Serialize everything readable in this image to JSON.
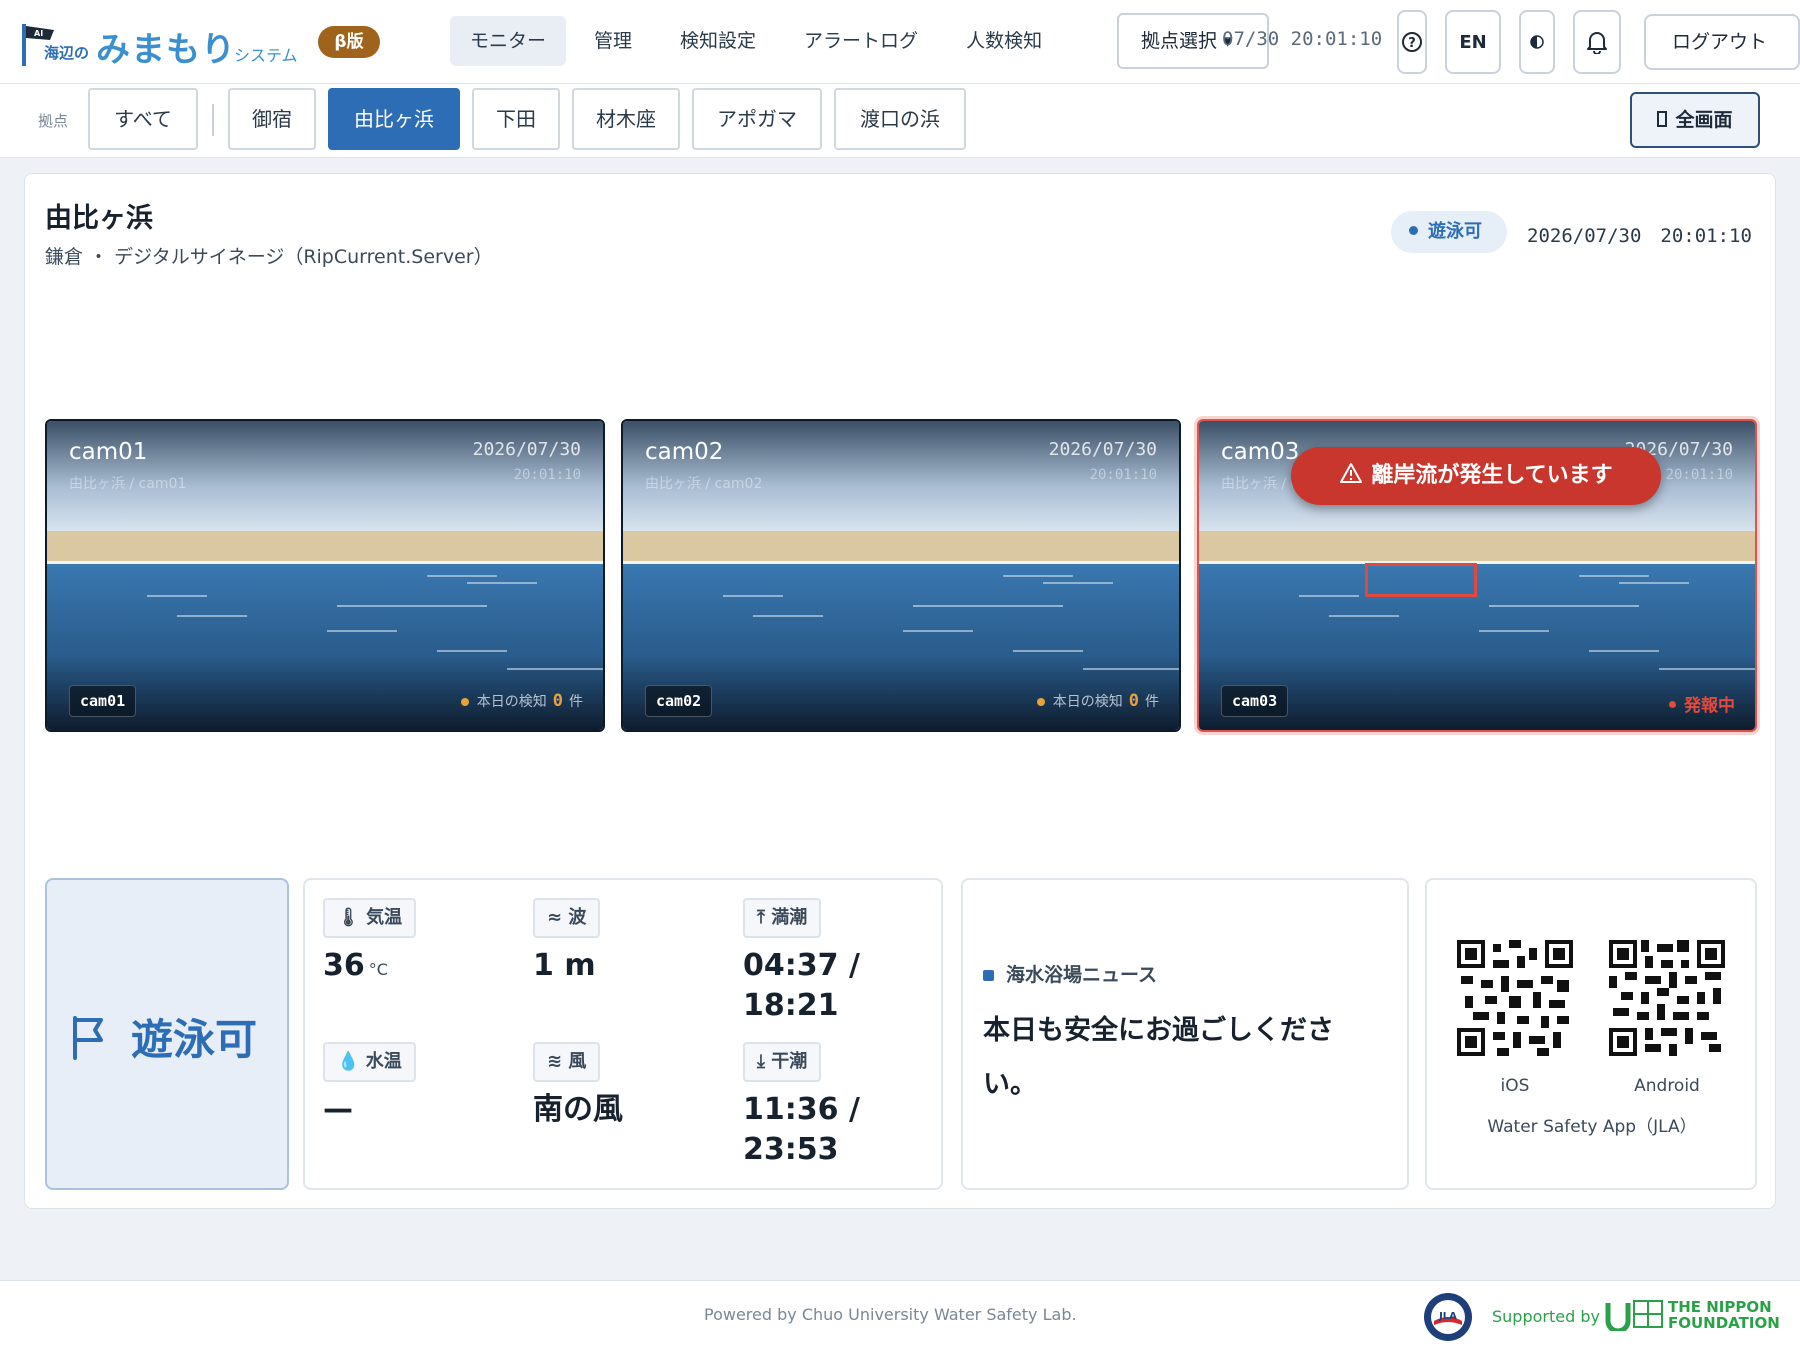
{
  "header": {
    "logo_small": "海辺の",
    "logo_main": "みまもり",
    "logo_system": "システム",
    "beta": "β版",
    "nav": [
      "モニター",
      "管理",
      "検知設定",
      "アラートログ",
      "人数検知"
    ],
    "location_select": "拠点選択 ▾",
    "clock": "07/30 20:01:10",
    "lang": "EN",
    "logout": "ログアウト"
  },
  "sites": {
    "label": "拠点",
    "all": "すべて",
    "items": [
      "御宿",
      "由比ヶ浜",
      "下田",
      "材木座",
      "アポガマ",
      "渡口の浜"
    ],
    "active": "由比ヶ浜",
    "fullscreen": "全画面"
  },
  "beach": {
    "title": "由比ヶ浜",
    "subtitle": "鎌倉 ・ デジタルサイネージ（RipCurrent.Server）",
    "status": "遊泳可",
    "datetime": "2026/07/30　20:01:10"
  },
  "cameras": [
    {
      "name": "cam01",
      "path": "由比ヶ浜 / cam01",
      "date": "2026/07/30",
      "time": "20:01:10",
      "chip": "cam01",
      "count_label": "本日の検知",
      "count": "0",
      "count_unit": "件"
    },
    {
      "name": "cam02",
      "path": "由比ヶ浜 / cam02",
      "date": "2026/07/30",
      "time": "20:01:10",
      "chip": "cam02",
      "count_label": "本日の検知",
      "count": "0",
      "count_unit": "件"
    },
    {
      "name": "cam03",
      "path": "由比ヶ浜 / cam03",
      "date": "2026/07/30",
      "time": "20:01:10",
      "chip": "cam03",
      "alert": "離岸流が発生しています",
      "firing": "発報中"
    }
  ],
  "swim_card": {
    "status": "遊泳可"
  },
  "weather": {
    "air_temp": {
      "label": "気温",
      "value": "36",
      "unit": "°C"
    },
    "wave": {
      "label": "波",
      "value": "1 m"
    },
    "high_tide": {
      "label": "満潮",
      "value1": "04:37 /",
      "value2": "18:21"
    },
    "water_temp": {
      "label": "水温",
      "value": "—"
    },
    "wind": {
      "label": "風",
      "value": "南の風"
    },
    "low_tide": {
      "label": "干潮",
      "value1": "11:36 /",
      "value2": "23:53"
    }
  },
  "news": {
    "header": "海水浴場ニュース",
    "body": "本日も安全にお過ごしください。"
  },
  "app": {
    "ios": "iOS",
    "android": "Android",
    "name": "Water Safety App（JLA）"
  },
  "footer": {
    "powered": "Powered by Chuo University Water Safety Lab.",
    "supported": "Supported by",
    "nippon_line1": "THE NIPPON",
    "nippon_line2": "FOUNDATION"
  },
  "colors": {
    "accent": "#2d6db5",
    "alert": "#c8362d",
    "beta": "#a0631c",
    "supported": "#2aa148"
  }
}
